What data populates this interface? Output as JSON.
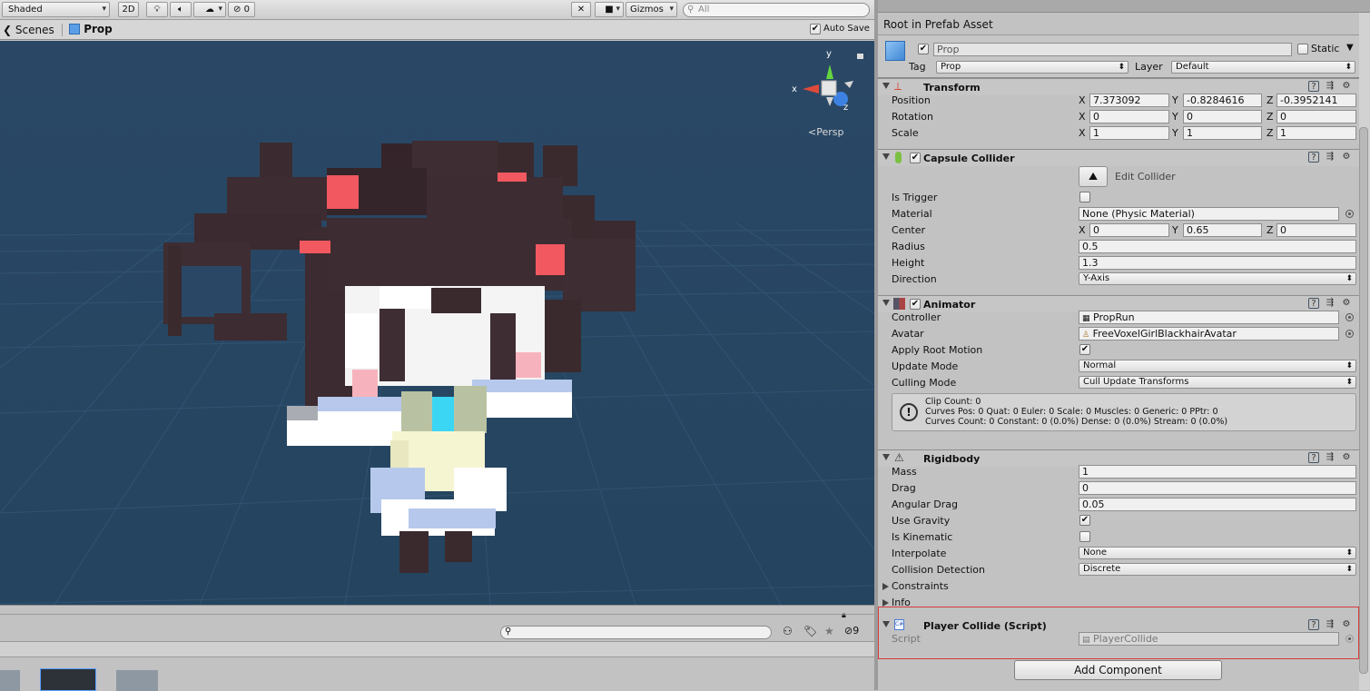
{
  "scene_toolbar": {
    "shading_mode": "Shaded",
    "mode_2d": "2D",
    "hidden_count": "0",
    "gizmos_label": "Gizmos",
    "search_placeholder": "All"
  },
  "breadcrumb": {
    "scenes_label": "Scenes",
    "prefab_name": "Prop",
    "auto_save_label": "Auto Save",
    "auto_save_checked": true
  },
  "viewport": {
    "persp_label": "Persp",
    "gizmo_axes": {
      "x": "x",
      "y": "y",
      "z": "z"
    }
  },
  "project_bar": {
    "search_placeholder": "",
    "hidden_count": "9"
  },
  "inspector": {
    "root_label": "Root in Prefab Asset",
    "object_name": "Prop",
    "static_label": "Static",
    "tag_label": "Tag",
    "tag_value": "Prop",
    "layer_label": "Layer",
    "layer_value": "Default",
    "transform": {
      "title": "Transform",
      "position_label": "Position",
      "rotation_label": "Rotation",
      "scale_label": "Scale",
      "position": {
        "x": "7.373092",
        "y": "-0.8284616",
        "z": "-0.3952141"
      },
      "rotation": {
        "x": "0",
        "y": "0",
        "z": "0"
      },
      "scale": {
        "x": "1",
        "y": "1",
        "z": "1"
      }
    },
    "capsule_collider": {
      "title": "Capsule Collider",
      "edit_collider_label": "Edit Collider",
      "is_trigger_label": "Is Trigger",
      "material_label": "Material",
      "material_value": "None (Physic Material)",
      "center_label": "Center",
      "center": {
        "x": "0",
        "y": "0.65",
        "z": "0"
      },
      "radius_label": "Radius",
      "radius_value": "0.5",
      "height_label": "Height",
      "height_value": "1.3",
      "direction_label": "Direction",
      "direction_value": "Y-Axis"
    },
    "animator": {
      "title": "Animator",
      "controller_label": "Controller",
      "controller_value": "PropRun",
      "avatar_label": "Avatar",
      "avatar_value": "FreeVoxelGirlBlackhairAvatar",
      "apply_root_motion_label": "Apply Root Motion",
      "update_mode_label": "Update Mode",
      "update_mode_value": "Normal",
      "culling_mode_label": "Culling Mode",
      "culling_mode_value": "Cull Update Transforms",
      "info_line1": "Clip Count: 0",
      "info_line2": "Curves Pos: 0 Quat: 0 Euler: 0 Scale: 0 Muscles: 0 Generic: 0 PPtr: 0",
      "info_line3": "Curves Count: 0 Constant: 0 (0.0%) Dense: 0 (0.0%) Stream: 0 (0.0%)"
    },
    "rigidbody": {
      "title": "Rigidbody",
      "mass_label": "Mass",
      "mass_value": "1",
      "drag_label": "Drag",
      "drag_value": "0",
      "angular_drag_label": "Angular Drag",
      "angular_drag_value": "0.05",
      "use_gravity_label": "Use Gravity",
      "is_kinematic_label": "Is Kinematic",
      "interpolate_label": "Interpolate",
      "interpolate_value": "None",
      "collision_detection_label": "Collision Detection",
      "collision_detection_value": "Discrete",
      "constraints_label": "Constraints",
      "info_label": "Info"
    },
    "player_collide": {
      "title": "Player Collide (Script)",
      "script_label": "Script",
      "script_value": "PlayerCollide"
    },
    "add_component_label": "Add Component"
  },
  "colors": {
    "viewport_bg": "#24445f",
    "hair": "#3a2a2e",
    "ribbon": "#f2585f",
    "skin": "#ffffff",
    "dress": "#f6f5d2",
    "sleeve": "#b6c9ec",
    "highlight": "#d83a3a"
  }
}
